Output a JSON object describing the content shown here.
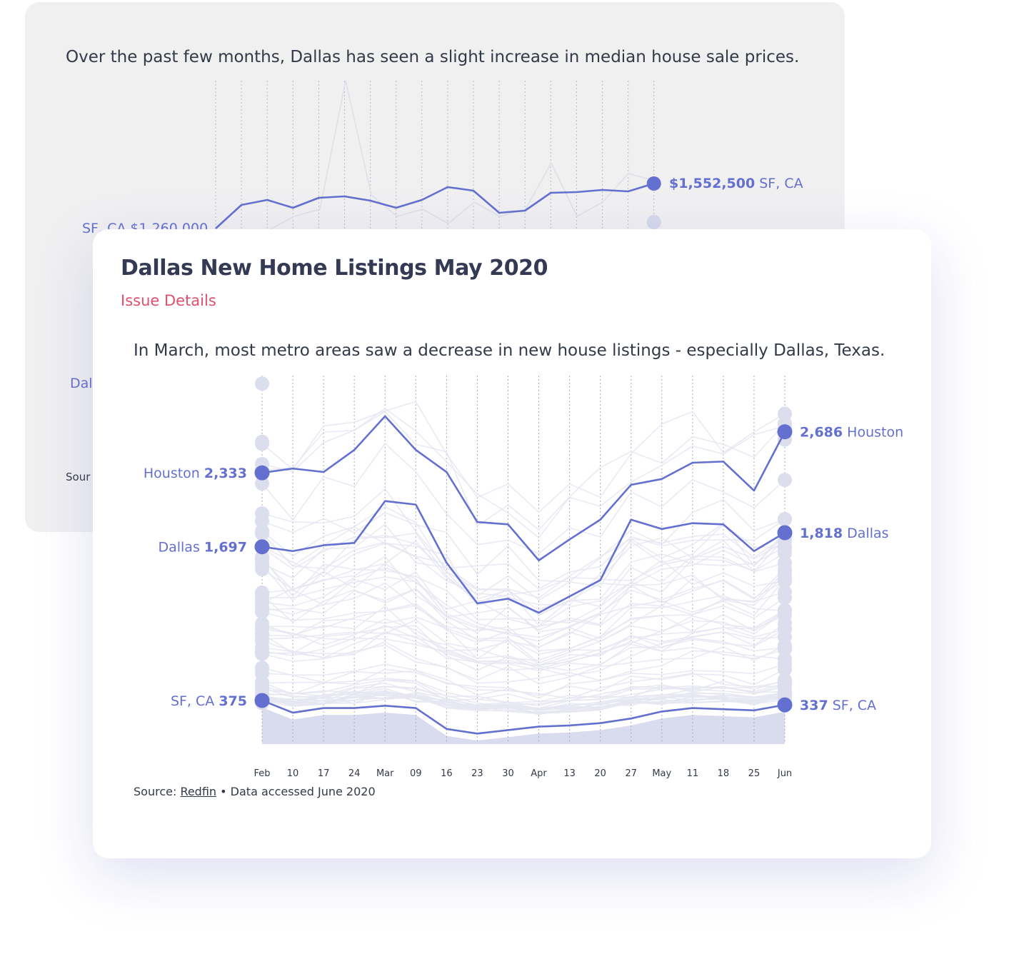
{
  "back_card": {
    "subtitle": "Over the past few months, Dallas has seen a slight increase in median house sale prices.",
    "end_value": "$1,552,500",
    "end_name": "SF, CA",
    "start_fragment": "SF, CA $1,260,000",
    "dallas_fragment": "Dal",
    "source_fragment": "Sour"
  },
  "front_card": {
    "title": "Dallas New Home Listings May 2020",
    "link": "Issue Details",
    "subtitle": "In March, most metro areas saw a decrease in new house listings - especially Dallas, Texas.",
    "source_prefix": "Source:",
    "source_link": "Redfin",
    "source_suffix": "• Data accessed June 2020"
  },
  "colors": {
    "highlight": "#6470cf",
    "background_line": "#e5e6f1",
    "accent_link": "#e2506d"
  },
  "chart_data": {
    "type": "line",
    "title": "Dallas New Home Listings May 2020",
    "x": [
      "Feb",
      "10",
      "17",
      "24",
      "Mar",
      "09",
      "16",
      "23",
      "30",
      "Apr",
      "13",
      "20",
      "27",
      "May",
      "11",
      "18",
      "25",
      "Jun"
    ],
    "ylim": [
      0,
      3200
    ],
    "series": [
      {
        "name": "Houston",
        "highlight": true,
        "values": [
          2333,
          2370,
          2340,
          2530,
          2820,
          2530,
          2340,
          1910,
          1890,
          1580,
          1760,
          1930,
          2230,
          2280,
          2420,
          2430,
          2180,
          2686
        ]
      },
      {
        "name": "Dallas",
        "highlight": true,
        "values": [
          1697,
          1660,
          1710,
          1730,
          2090,
          2060,
          1560,
          1210,
          1250,
          1130,
          1270,
          1410,
          1930,
          1850,
          1900,
          1890,
          1660,
          1818
        ]
      },
      {
        "name": "SF, CA",
        "highlight": true,
        "values": [
          375,
          270,
          310,
          310,
          330,
          310,
          130,
          90,
          120,
          150,
          160,
          180,
          220,
          280,
          310,
          300,
          290,
          337
        ]
      }
    ],
    "labels": {
      "start": [
        {
          "series": "Houston",
          "value": "2,333"
        },
        {
          "series": "Dallas",
          "value": "1,697"
        },
        {
          "series": "SF, CA",
          "value": "375"
        }
      ],
      "end": [
        {
          "series": "Houston",
          "value": "2,686"
        },
        {
          "series": "Dallas",
          "value": "1,818"
        },
        {
          "series": "SF, CA",
          "value": "337"
        }
      ]
    },
    "background_series_count": 60
  }
}
